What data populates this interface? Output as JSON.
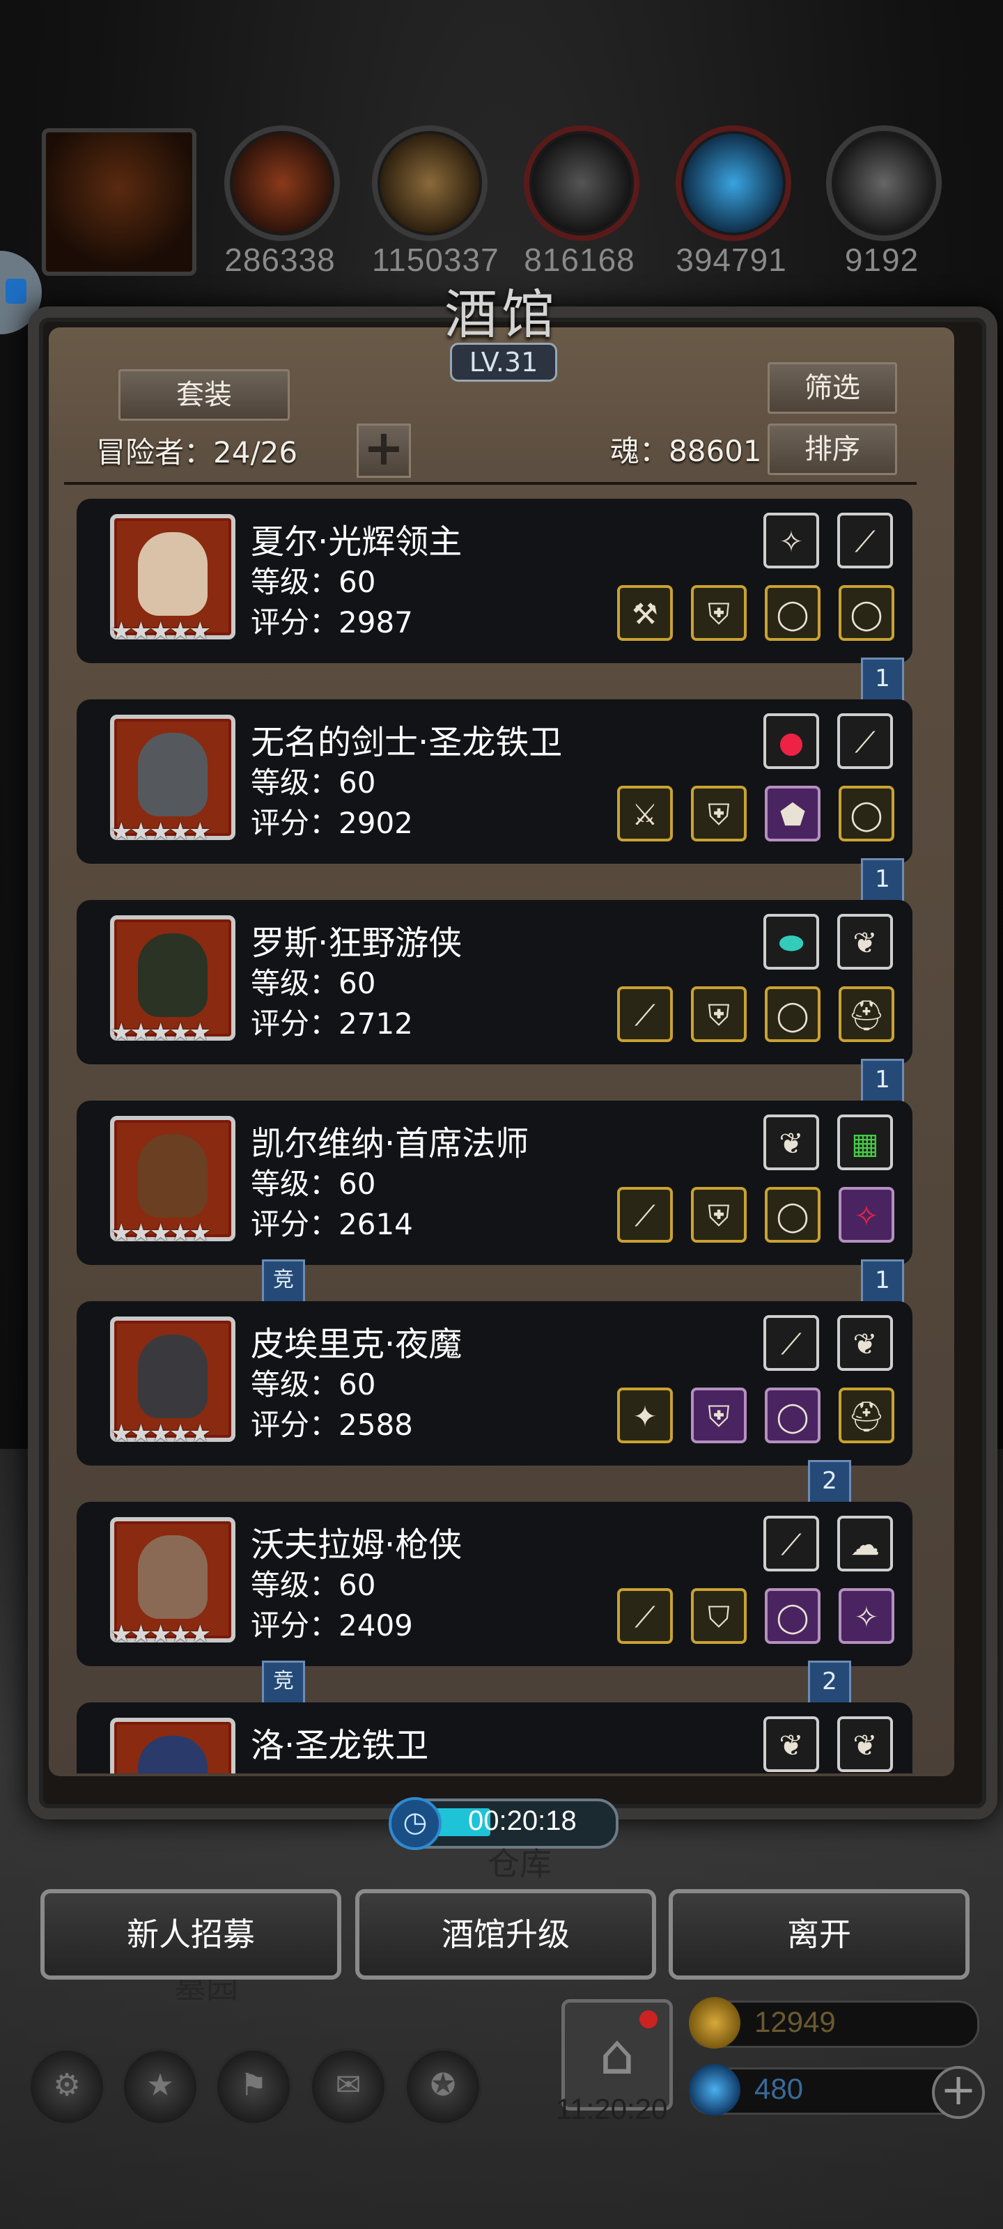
{
  "resources": [
    {
      "icon": "meat-icon",
      "value": "286338"
    },
    {
      "icon": "wood-icon",
      "value": "1150337"
    },
    {
      "icon": "iron-icon",
      "value": "816168"
    },
    {
      "icon": "crystal-icon",
      "value": "394791"
    },
    {
      "icon": "ore-icon",
      "value": "9192"
    }
  ],
  "tavern": {
    "title": "酒馆",
    "level": "LV.31",
    "set_button": "套装",
    "filter_button": "筛选",
    "sort_button": "排序",
    "adventurers_label": "冒险者：24/26",
    "soul_label": "魂：88601"
  },
  "heroes": [
    {
      "name": "夏尔·光辉领主",
      "level": "等级：60",
      "score": "评分：2987",
      "stars": "★★★★★",
      "ribbon": "1",
      "badge": ""
    },
    {
      "name": "无名的剑士·圣龙铁卫",
      "level": "等级：60",
      "score": "评分：2902",
      "stars": "★★★★★",
      "ribbon": "1",
      "badge": ""
    },
    {
      "name": "罗斯·狂野游侠",
      "level": "等级：60",
      "score": "评分：2712",
      "stars": "★★★★★",
      "ribbon": "1",
      "badge": ""
    },
    {
      "name": "凯尔维纳·首席法师",
      "level": "等级：60",
      "score": "评分：2614",
      "stars": "★★★★★",
      "ribbon": "1",
      "badge": "竞"
    },
    {
      "name": "皮埃里克·夜魔",
      "level": "等级：60",
      "score": "评分：2588",
      "stars": "★★★★★",
      "ribbon": "2",
      "badge": ""
    },
    {
      "name": "沃夫拉姆·枪侠",
      "level": "等级：60",
      "score": "评分：2409",
      "stars": "★★★★★",
      "ribbon": "2",
      "badge": "竞"
    },
    {
      "name": "洛·圣龙铁卫",
      "level": "",
      "score": "",
      "stars": "",
      "ribbon": "",
      "badge": ""
    }
  ],
  "timer": "00:20:18",
  "buttons": {
    "recruit": "新人招募",
    "upgrade": "酒馆升级",
    "leave": "离开"
  },
  "background_text": {
    "warehouse": "仓库",
    "cemetery": "墓园"
  },
  "gift_timer": "11:20:20",
  "currency": {
    "gold": "12949",
    "gems": "480"
  }
}
